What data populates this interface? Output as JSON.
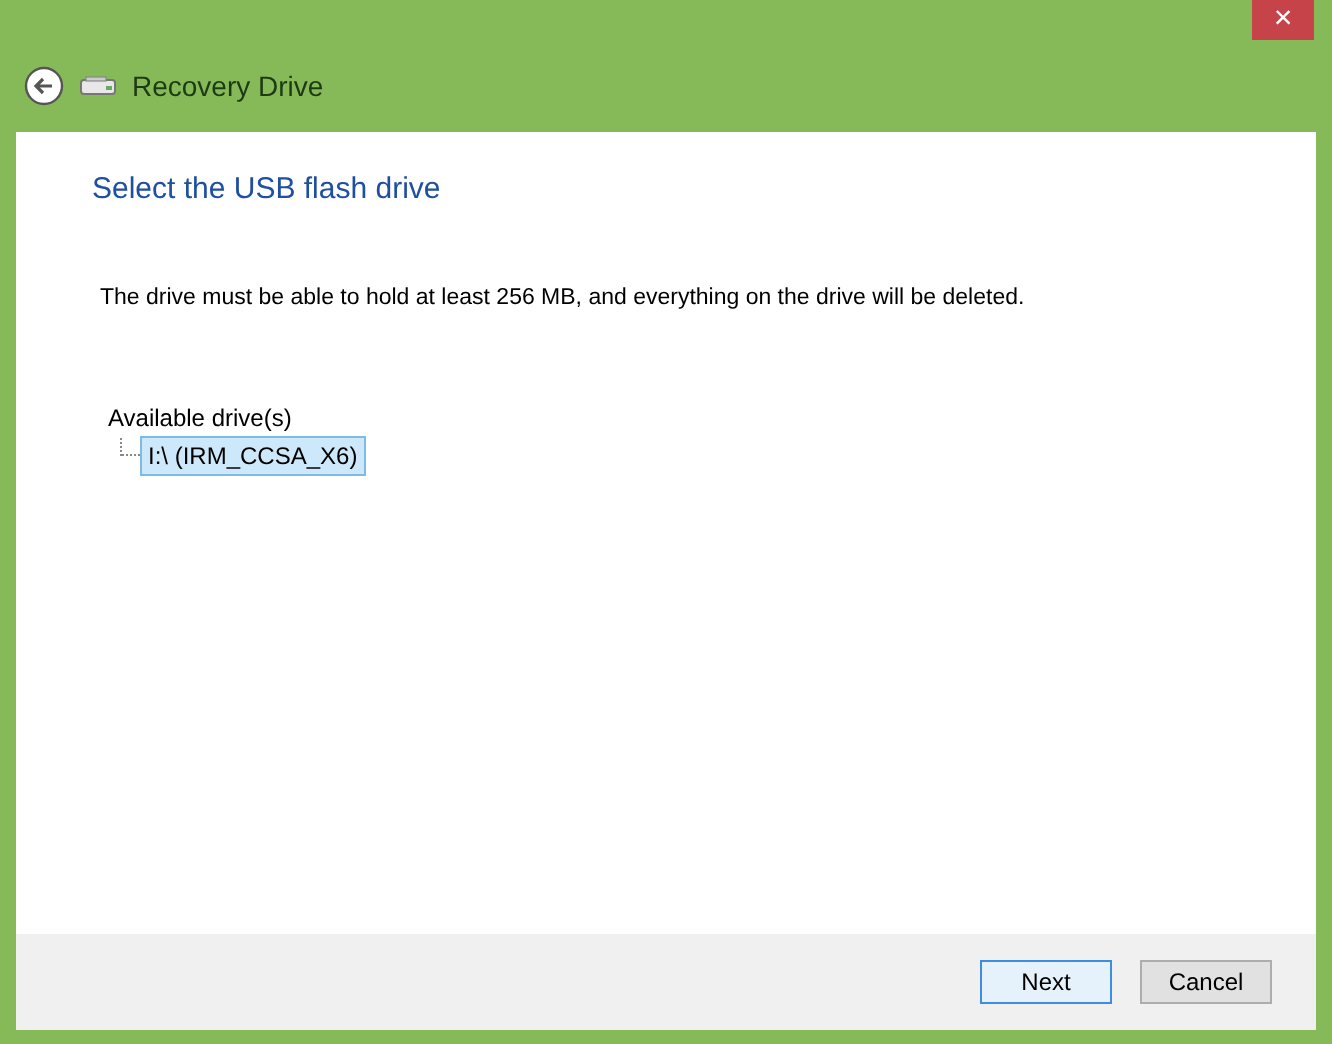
{
  "window": {
    "title": "Recovery Drive",
    "close": "×"
  },
  "heading": "Select the USB flash drive",
  "description": "The drive must be able to hold at least 256 MB, and everything on the drive will be deleted.",
  "drives": {
    "label": "Available drive(s)",
    "items": [
      {
        "label": "I:\\ (IRM_CCSA_X6)",
        "selected": true
      }
    ]
  },
  "buttons": [
    {
      "label": "Next",
      "kind": "default"
    },
    {
      "label": "Cancel",
      "kind": "normal"
    }
  ]
}
